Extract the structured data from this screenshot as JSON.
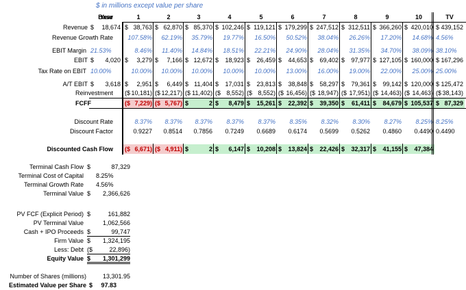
{
  "caption": "$ in millions except value per share",
  "headers": [
    "Year",
    "Base",
    "1",
    "2",
    "3",
    "4",
    "5",
    "6",
    "7",
    "8",
    "9",
    "10",
    "TV"
  ],
  "rows": [
    {
      "id": "revenue",
      "label": "Revenue",
      "base": "$ 18,674",
      "vals": [
        "$38,763",
        "$62,870",
        "$85,370",
        "$102,246",
        "$119,121",
        "$179,299",
        "$247,512",
        "$312,511",
        "$366,260",
        "$420,010"
      ],
      "tv": "$439,152",
      "type": "normal"
    },
    {
      "id": "growth",
      "label": "Revenue Growth Rate",
      "base": "",
      "vals": [
        "107.58%",
        "62.19%",
        "35.79%",
        "19.77%",
        "16.50%",
        "50.52%",
        "38.04%",
        "26.26%",
        "17.20%",
        "14.68%"
      ],
      "tv": "4.56%",
      "type": "blue"
    },
    {
      "id": "ebit_margin",
      "label": "EBIT Margin",
      "base": "21.53%",
      "vals": [
        "8.46%",
        "11.40%",
        "14.84%",
        "18.51%",
        "22.21%",
        "24.90%",
        "28.04%",
        "31.35%",
        "34.70%",
        "38.09%"
      ],
      "tv": "38.10%",
      "type": "blue"
    },
    {
      "id": "ebit",
      "label": "EBIT",
      "base": "$ 4,020",
      "vals": [
        "$ 3,279",
        "$ 7,166",
        "$12,672",
        "$ 18,923",
        "$ 26,459",
        "$ 44,653",
        "$ 69,402",
        "$ 97,977",
        "$127,105",
        "$160,000"
      ],
      "tv": "$167,296",
      "type": "normal"
    },
    {
      "id": "tax",
      "label": "Tax Rate on EBIT",
      "base": "10.00%",
      "vals": [
        "10.00%",
        "10.00%",
        "10.00%",
        "10.00%",
        "10.00%",
        "13.00%",
        "16.00%",
        "19.00%",
        "22.00%",
        "25.00%"
      ],
      "tv": "25.00%",
      "type": "blue"
    },
    {
      "id": "atebit",
      "label": "A/T EBIT",
      "base": "$ 3,618",
      "vals": [
        "$ 2,951",
        "$ 6,449",
        "$11,404",
        "$ 17,031",
        "$ 23,813",
        "$ 38,848",
        "$ 58,297",
        "$ 79,361",
        "$ 99,142",
        "$120,000"
      ],
      "tv": "$125,472",
      "type": "normal"
    },
    {
      "id": "reinv",
      "label": "Reinvestment",
      "base": "",
      "vals": [
        "($10,181)",
        "($12,217)",
        "($11,402)",
        "($ 8,552)",
        "($ 8,552)",
        "($ 16,456)",
        "($ 18,947)",
        "($ 17,951)",
        "($ 14,463)",
        "($ 14,463)"
      ],
      "tv": "($ 38,143)",
      "type": "normal"
    },
    {
      "id": "fcff",
      "label": "FCFF",
      "base": "",
      "vals": [
        "($ 7,229)",
        "($ 5,767)",
        "$ 2",
        "$ 8,479",
        "$ 15,261",
        "$ 22,392",
        "$ 39,350",
        "$ 61,411",
        "$ 84,679",
        "$105,537"
      ],
      "tv": "$ 87,329",
      "type": "bold"
    },
    {
      "id": "disc_rate",
      "label": "Discount Rate",
      "base": "",
      "vals": [
        "8.37%",
        "8.37%",
        "8.37%",
        "8.37%",
        "8.37%",
        "8.35%",
        "8.32%",
        "8.30%",
        "8.27%",
        "8.25%"
      ],
      "tv": "8.25%",
      "type": "blue"
    },
    {
      "id": "disc_factor",
      "label": "Discount Factor",
      "base": "",
      "vals": [
        "0.9227",
        "0.8514",
        "0.7856",
        "0.7249",
        "0.6689",
        "0.6174",
        "0.5699",
        "0.5262",
        "0.4860",
        "0.4490"
      ],
      "tv": "0.4490",
      "type": "normal"
    },
    {
      "id": "dcf",
      "label": "Discounted Cash Flow",
      "base": "",
      "vals": [
        "($ 6,671)",
        "($ 4,911)",
        "$ 2",
        "$ 6,147",
        "$ 10,208",
        "$ 13,824",
        "$ 22,426",
        "$ 32,317",
        "$ 41,155",
        "$ 47,384"
      ],
      "tv": "",
      "type": "bold"
    }
  ],
  "summary": [
    {
      "label": "Terminal Cash Flow",
      "value": "$ 87,329"
    },
    {
      "label": "Terminal Cost of Capital",
      "value": "8.25%"
    },
    {
      "label": "Terminal Growth Rate",
      "value": "4.56%"
    },
    {
      "label": "Terminal Value",
      "value": "$ 2,366,626"
    },
    {
      "label": "PV FCF (Explicit Period)",
      "value": "$ 161,882"
    },
    {
      "label": "PV Terminal Value",
      "value": "1,062,566"
    },
    {
      "label": "Cash + IPO Proceeds",
      "value": "$ 99,747"
    },
    {
      "label": "Firm Value",
      "value": "$ 1,324,195"
    },
    {
      "label": "Less: Debt",
      "value": "($ 22,896)"
    },
    {
      "label": "Equity Value",
      "value": "$ 1,301,299"
    },
    {
      "label": "Number of Shares (millions)",
      "value": "13,301.95"
    },
    {
      "label": "Estimated Value per Share",
      "value": "$ 97.83"
    }
  ],
  "colors": {
    "red_fill": "#F4CCCC",
    "red_text": "#C00000",
    "green_fill": "#C6EFCE",
    "blue_text": "#4472C4"
  }
}
